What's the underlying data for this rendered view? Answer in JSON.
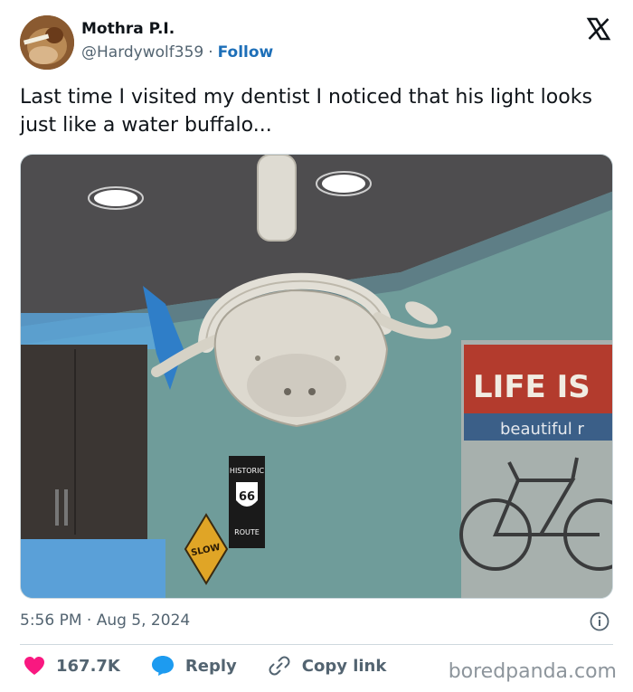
{
  "author": {
    "name": "Mothra P.I.",
    "handle": "@Hardywolf359",
    "separator": "·",
    "follow_label": "Follow"
  },
  "tweet": {
    "text": "Last time I visited my dentist I noticed that his light looks just like a water buffalo..."
  },
  "photo": {
    "signs": {
      "poster_line1": "LIFE IS",
      "poster_line2": "beautiful r",
      "route_top": "HISTORIC",
      "route_number": "66",
      "route_bottom": "ROUTE",
      "slow": "SLOW"
    }
  },
  "meta": {
    "timestamp": "5:56 PM · Aug 5, 2024"
  },
  "actions": {
    "like_count": "167.7K",
    "reply_label": "Reply",
    "copy_label": "Copy link"
  },
  "watermark": "boredpanda.com",
  "colors": {
    "like": "#f91880",
    "reply": "#1d9bf0",
    "link": "#1d6fb8"
  },
  "icons": [
    "x-logo-icon",
    "info-icon",
    "heart-icon",
    "reply-bubble-icon",
    "link-icon"
  ]
}
